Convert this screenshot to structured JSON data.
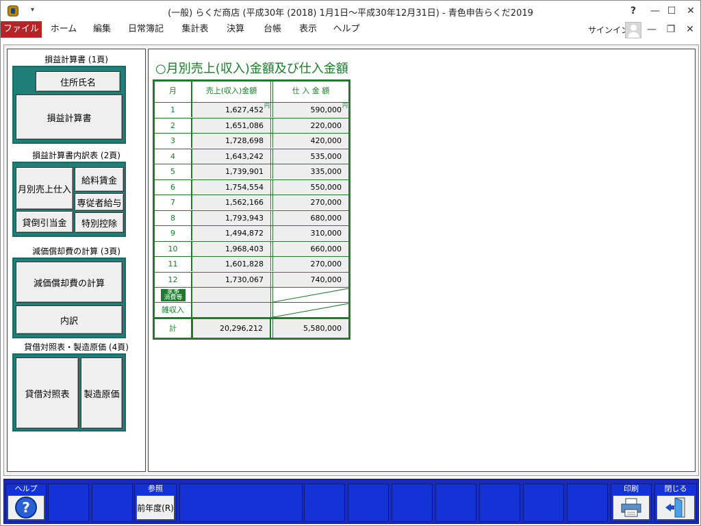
{
  "window": {
    "title": "(一般) らくだ商店 (平成30年 (2018) 1月1日～平成30年12月31日) - 青色申告らくだ2019",
    "help_glyph": "?",
    "min_glyph": "—",
    "max_glyph": "☐",
    "close_glyph": "✕",
    "app_icon": "raku-da-app-icon"
  },
  "menu": {
    "items": [
      "ファイル",
      "ホーム",
      "編集",
      "日常簿記",
      "集計表",
      "決算",
      "台帳",
      "表示",
      "ヘルプ"
    ],
    "signin": "サインイン"
  },
  "sidebar": {
    "sec1_title": "損益計算書 (1頁)",
    "sec1_buttons": {
      "address": "住所氏名",
      "pl": "損益計算書"
    },
    "sec2_title": "損益計算書内訳表 (2頁)",
    "sec2_buttons": {
      "monthly": "月別売上仕入",
      "salary": "給料賃金",
      "family": "専従者給与",
      "bad_debt": "貸倒引当金",
      "deduction": "特別控除"
    },
    "sec3_title": "減価償却費の計算 (3頁)",
    "sec3_buttons": {
      "depr": "減価償却費の計算",
      "detail": "内訳"
    },
    "sec4_title": "貸借対照表・製造原価 (4頁)",
    "sec4_buttons": {
      "bs": "貸借対照表",
      "mfg": "製造原価"
    }
  },
  "main": {
    "heading": "○月別売上(収入)金額及び仕入金額",
    "headers": {
      "month": "月",
      "sales": "売上(収入)金額",
      "purchase": "仕 入 金 額"
    },
    "yen_mark": "円",
    "rows": [
      {
        "month": "1",
        "sales": "1,627,452",
        "purchase": "590,000"
      },
      {
        "month": "2",
        "sales": "1,651,086",
        "purchase": "220,000"
      },
      {
        "month": "3",
        "sales": "1,728,698",
        "purchase": "420,000"
      },
      {
        "month": "4",
        "sales": "1,643,242",
        "purchase": "535,000"
      },
      {
        "month": "5",
        "sales": "1,739,901",
        "purchase": "335,000"
      },
      {
        "month": "6",
        "sales": "1,754,554",
        "purchase": "550,000"
      },
      {
        "month": "7",
        "sales": "1,562,166",
        "purchase": "270,000"
      },
      {
        "month": "8",
        "sales": "1,793,943",
        "purchase": "680,000"
      },
      {
        "month": "9",
        "sales": "1,494,872",
        "purchase": "310,000"
      },
      {
        "month": "10",
        "sales": "1,968,403",
        "purchase": "660,000"
      },
      {
        "month": "11",
        "sales": "1,601,828",
        "purchase": "270,000"
      },
      {
        "month": "12",
        "sales": "1,730,067",
        "purchase": "740,000"
      }
    ],
    "kaji_label_1": "家事",
    "kaji_label_2": "消費等",
    "misc_label": "雑収入",
    "total_label": "計",
    "total_sales": "20,296,212",
    "total_purchase": "5,580,000"
  },
  "footer": {
    "help_label": "ヘルプ",
    "ref_label": "参照",
    "prev_year": "前年度(R)",
    "print_label": "印刷",
    "close_label": "閉じる",
    "help_icon": "help-question-icon",
    "print_icon": "printer-icon",
    "close_icon": "exit-door-icon"
  },
  "colors": {
    "menu_file_bg": "#b52527",
    "teal": "#1f7f78",
    "table_green": "#1e7a2d",
    "footer_blue": "#1a2bb8"
  }
}
